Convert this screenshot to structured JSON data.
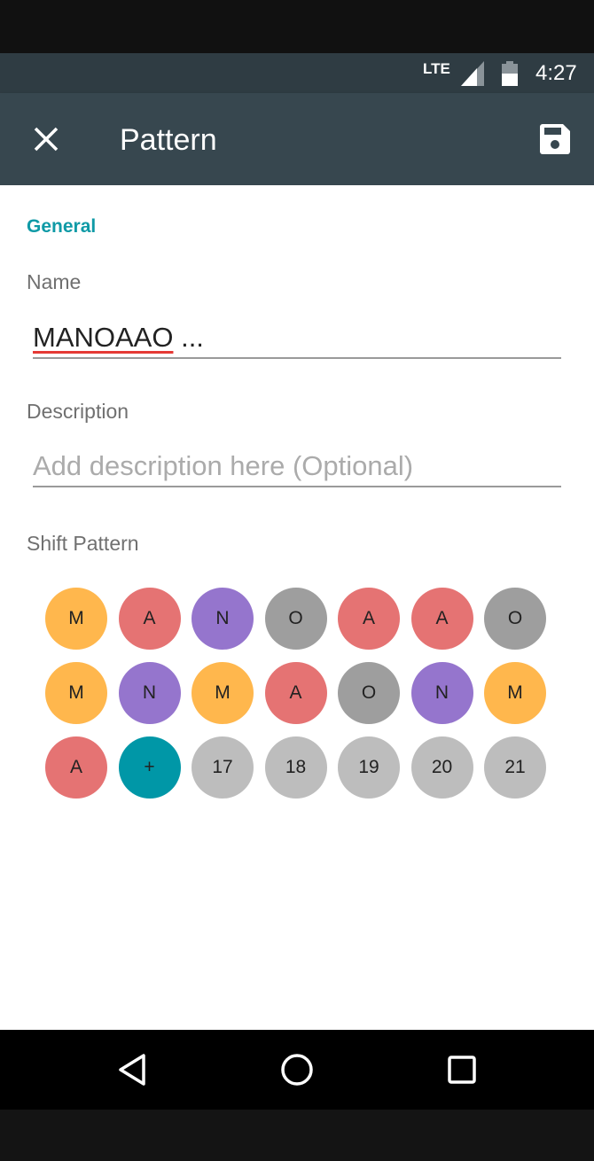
{
  "status_bar": {
    "network": "LTE",
    "time": "4:27"
  },
  "toolbar": {
    "close_icon": "close-icon",
    "title": "Pattern",
    "save_icon": "save-icon"
  },
  "form": {
    "section_header": "General",
    "name_label": "Name",
    "name_value": "MANOAAO",
    "name_ellipsis": " ...",
    "description_label": "Description",
    "description_placeholder": "Add description here (Optional)",
    "shift_pattern_label": "Shift Pattern"
  },
  "shift_colors": {
    "M": "#ffb74d",
    "A": "#e57373",
    "N": "#9575cd",
    "O": "#9e9e9e",
    "add": "#0097a7",
    "empty": "#bdbdbd"
  },
  "shift_pattern": {
    "rows": [
      [
        {
          "label": "M",
          "kind": "M"
        },
        {
          "label": "A",
          "kind": "A"
        },
        {
          "label": "N",
          "kind": "N"
        },
        {
          "label": "O",
          "kind": "O"
        },
        {
          "label": "A",
          "kind": "A"
        },
        {
          "label": "A",
          "kind": "A"
        },
        {
          "label": "O",
          "kind": "O"
        }
      ],
      [
        {
          "label": "M",
          "kind": "M"
        },
        {
          "label": "N",
          "kind": "N"
        },
        {
          "label": "M",
          "kind": "M"
        },
        {
          "label": "A",
          "kind": "A"
        },
        {
          "label": "O",
          "kind": "O"
        },
        {
          "label": "N",
          "kind": "N"
        },
        {
          "label": "M",
          "kind": "M"
        }
      ],
      [
        {
          "label": "A",
          "kind": "A"
        },
        {
          "label": "+",
          "kind": "add"
        },
        {
          "label": "17",
          "kind": "empty"
        },
        {
          "label": "18",
          "kind": "empty"
        },
        {
          "label": "19",
          "kind": "empty"
        },
        {
          "label": "20",
          "kind": "empty"
        },
        {
          "label": "21",
          "kind": "empty"
        }
      ]
    ]
  },
  "nav_bar": {
    "back_icon": "back-triangle-icon",
    "home_icon": "home-circle-icon",
    "recents_icon": "recents-square-icon"
  }
}
